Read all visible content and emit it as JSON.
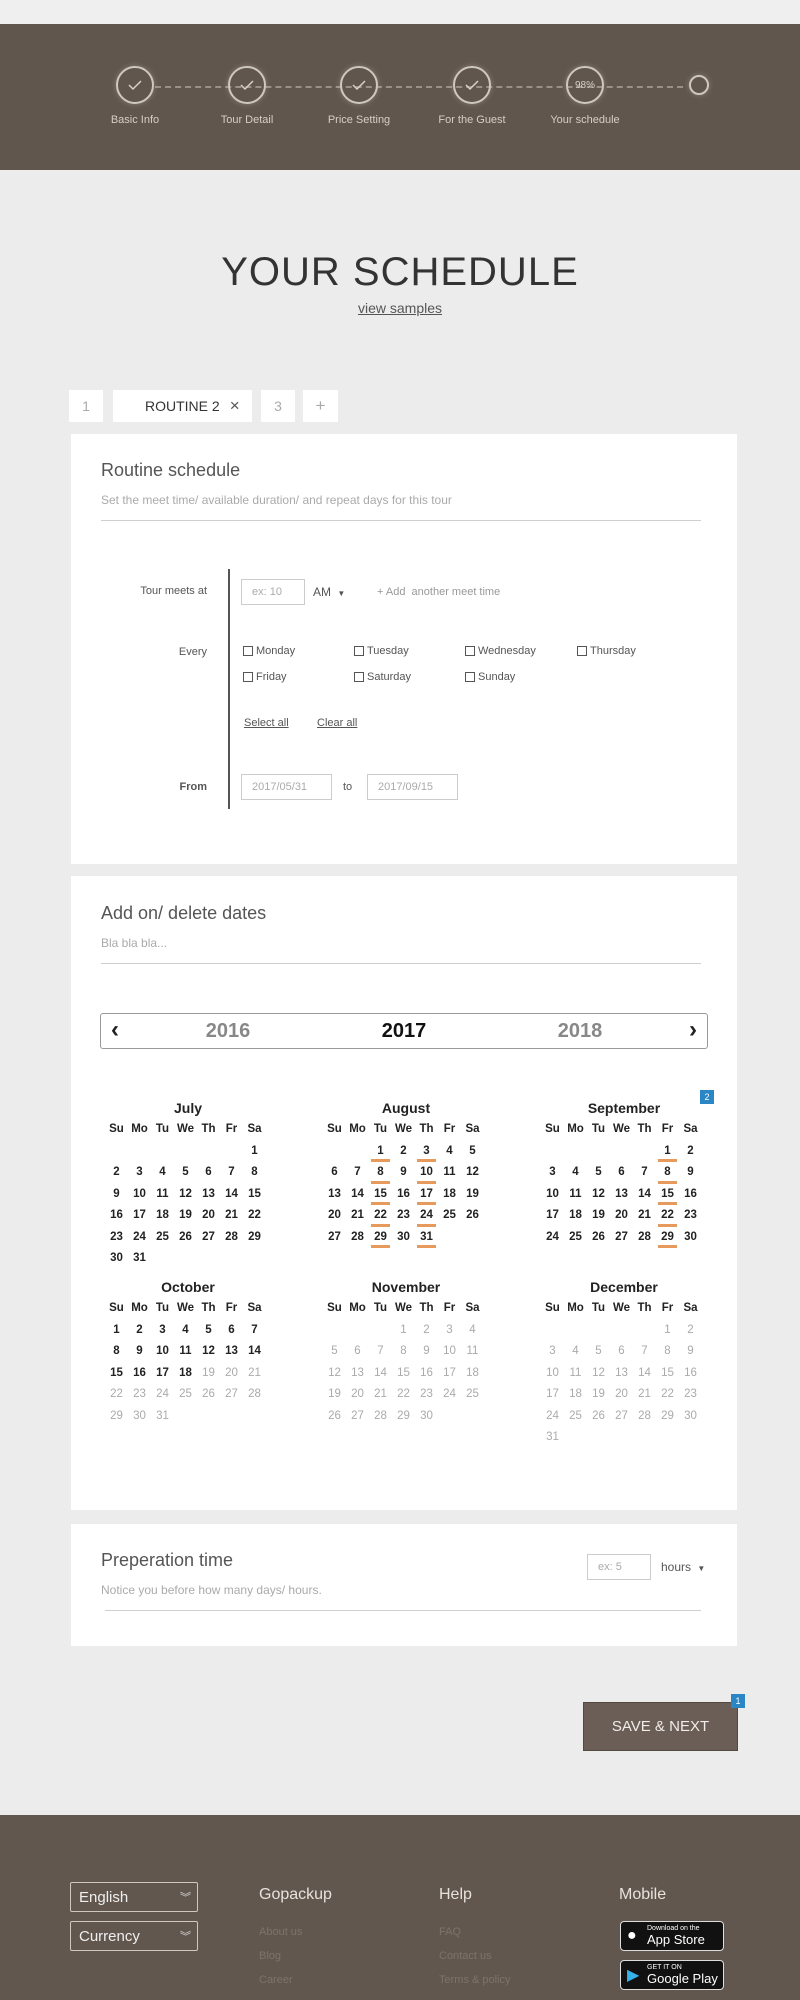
{
  "progress": {
    "steps": [
      {
        "label": "Basic Info",
        "icon": "check-icon"
      },
      {
        "label": "Tour Detail",
        "icon": "check-icon"
      },
      {
        "label": "Price Setting",
        "icon": "check-icon"
      },
      {
        "label": "For the Guest",
        "icon": "check-icon"
      },
      {
        "label": "Your schedule",
        "percent": "98%"
      }
    ]
  },
  "page": {
    "title": "YOUR SCHEDULE",
    "view_samples": "view samples"
  },
  "tabs": [
    {
      "label": "1"
    },
    {
      "label": "ROUTINE 2",
      "active": true,
      "close_icon": "×"
    },
    {
      "label": "3"
    },
    {
      "label": "+"
    }
  ],
  "routine": {
    "title": "Routine schedule",
    "subtitle": "Set the meet time/ available duration/ and repeat days for this tour",
    "meets_label": "Tour meets at",
    "time_placeholder": "ex: 10",
    "ampm": "AM",
    "add_meet_time": "+ Add  another meet time",
    "every_label": "Every",
    "days": [
      "Monday",
      "Tuesday",
      "Wednesday",
      "Thursday",
      "Friday",
      "Saturday",
      "Sunday"
    ],
    "select_all": "Select all",
    "clear_all": "Clear all",
    "from_label": "From",
    "from_date": "2017/05/31",
    "to_label": "to",
    "to_date": "2017/09/15"
  },
  "addon": {
    "title": "Add on/ delete dates",
    "subtitle": "Bla bla bla...",
    "years": [
      "2016",
      "2017",
      "2018"
    ],
    "selected_year": "2017",
    "weekdays": [
      "Su",
      "Mo",
      "Tu",
      "We",
      "Th",
      "Fr",
      "Sa"
    ],
    "badge": "2",
    "months": [
      {
        "name": "July",
        "start": 6,
        "days": 31,
        "selected": [],
        "grey_from": 32
      },
      {
        "name": "August",
        "start": 2,
        "days": 31,
        "selected": [
          1,
          3,
          8,
          10,
          15,
          17,
          22,
          24,
          29,
          31
        ],
        "grey_from": 32
      },
      {
        "name": "September",
        "start": 5,
        "days": 30,
        "selected": [
          1,
          8,
          15,
          22,
          29
        ],
        "grey_from": 31
      },
      {
        "name": "October",
        "start": 0,
        "days": 31,
        "selected": [],
        "grey_from": 19
      },
      {
        "name": "November",
        "start": 3,
        "days": 30,
        "selected": [],
        "grey_from": 1
      },
      {
        "name": "December",
        "start": 5,
        "days": 31,
        "selected": [],
        "grey_from": 1
      }
    ]
  },
  "prep": {
    "title": "Preperation time",
    "subtitle": "Notice you before how many days/ hours.",
    "placeholder": "ex: 5",
    "unit": "hours"
  },
  "save": {
    "label": "SAVE & NEXT",
    "badge": "1"
  },
  "footer": {
    "language": "English",
    "currency": "Currency",
    "columns": [
      {
        "heading": "Gopackup",
        "links": [
          "About us",
          "Blog",
          "Career"
        ]
      },
      {
        "heading": "Help",
        "links": [
          "FAQ",
          "Contact us",
          "Terms & policy"
        ]
      },
      {
        "heading": "Mobile"
      }
    ],
    "app_store": {
      "small": "Download on the",
      "big": "App Store"
    },
    "google_play": {
      "small": "GET IT ON",
      "big": "Google Play"
    }
  }
}
